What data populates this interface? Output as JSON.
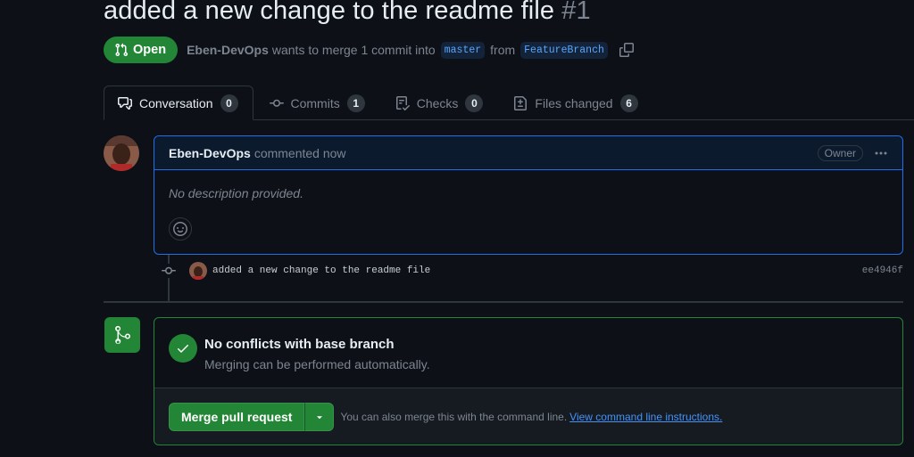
{
  "pr": {
    "title": "added a new change to the readme file",
    "number": "#1",
    "state": "Open",
    "author": "Eben-DevOps",
    "merge_text": "wants to merge 1 commit into",
    "base_branch": "master",
    "from_text": "from",
    "head_branch": "FeatureBranch"
  },
  "tabs": [
    {
      "label": "Conversation",
      "count": "0",
      "icon": "comment-discussion-icon"
    },
    {
      "label": "Commits",
      "count": "1",
      "icon": "git-commit-icon"
    },
    {
      "label": "Checks",
      "count": "0",
      "icon": "checklist-icon"
    },
    {
      "label": "Files changed",
      "count": "6",
      "icon": "file-diff-icon"
    }
  ],
  "comment": {
    "author": "Eben-DevOps",
    "action": "commented now",
    "badge": "Owner",
    "body": "No description provided."
  },
  "commit": {
    "message": "added a new change to the readme file",
    "sha": "ee4946f"
  },
  "merge": {
    "heading": "No conflicts with base branch",
    "subtext": "Merging can be performed automatically.",
    "button_label": "Merge pull request",
    "cli_text": "You can also merge this with the command line.",
    "cli_link": "View command line instructions."
  },
  "colors": {
    "accent_green": "#238636",
    "link_blue": "#4493f8",
    "background": "#0d1117",
    "border": "#30363d"
  }
}
